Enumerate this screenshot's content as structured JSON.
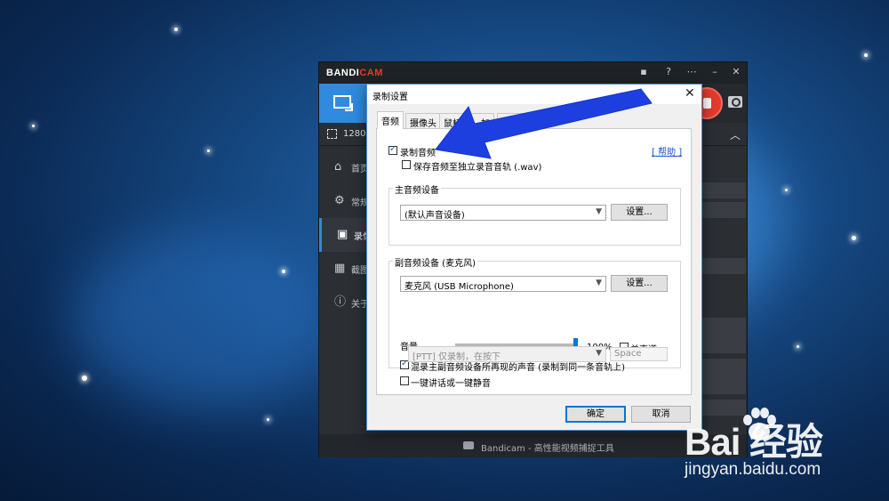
{
  "window": {
    "brand_prefix": "BANDI",
    "brand_suffix": "CAM",
    "resolution_text": "1280x",
    "footer_text": "Bandicam - 高性能视频捕捉工具"
  },
  "sidebar": {
    "items": [
      {
        "label": "首页",
        "icon": "home-icon"
      },
      {
        "label": "常规",
        "icon": "gear-icon"
      },
      {
        "label": "录像",
        "icon": "video-record-icon"
      },
      {
        "label": "截图",
        "icon": "image-icon"
      },
      {
        "label": "关于",
        "icon": "info-icon"
      }
    ]
  },
  "dialog": {
    "title": "录制设置",
    "close_glyph": "✕",
    "tabs": [
      {
        "label": "音频",
        "active": true
      },
      {
        "label": "摄像头",
        "active": false
      },
      {
        "label": "鼠标",
        "active": false
      },
      {
        "label": "…加",
        "active": false
      },
      {
        "label": "选项",
        "active": false
      }
    ],
    "record_audio": {
      "label": "录制音频",
      "checked": true
    },
    "help_link": "[ 帮助 ]",
    "save_separate": {
      "label": "保存音频至独立录音音轨 (.wav)",
      "checked": false
    },
    "primary_device": {
      "legend": "主音频设备",
      "selected": "(默认声音设备)",
      "settings_label": "设置..."
    },
    "secondary_device": {
      "legend": "副音频设备 (麦克风)",
      "selected": "麦克风 (USB Microphone)",
      "settings_label": "设置...",
      "volume_label": "音量",
      "volume_percent": 100,
      "volume_text": "100%",
      "mono": {
        "label": "单声道",
        "checked": false
      },
      "mix": {
        "label": "混录主副音频设备所再现的声音 (录制到同一条音轨上)",
        "checked": true
      },
      "ptt": {
        "label": "一键讲话或一键静音",
        "checked": false
      },
      "ptt_mode": "[PTT] 仅录制，在按下",
      "ptt_key": "Space"
    },
    "ok_label": "确定",
    "cancel_label": "取消"
  },
  "watermark": {
    "brand": "Bai  经验",
    "url": "jingyan.baidu.com"
  },
  "colors": {
    "accent": "#2f8ae0",
    "record_red": "#e53a2f",
    "arrow_blue": "#1e3fe0"
  }
}
